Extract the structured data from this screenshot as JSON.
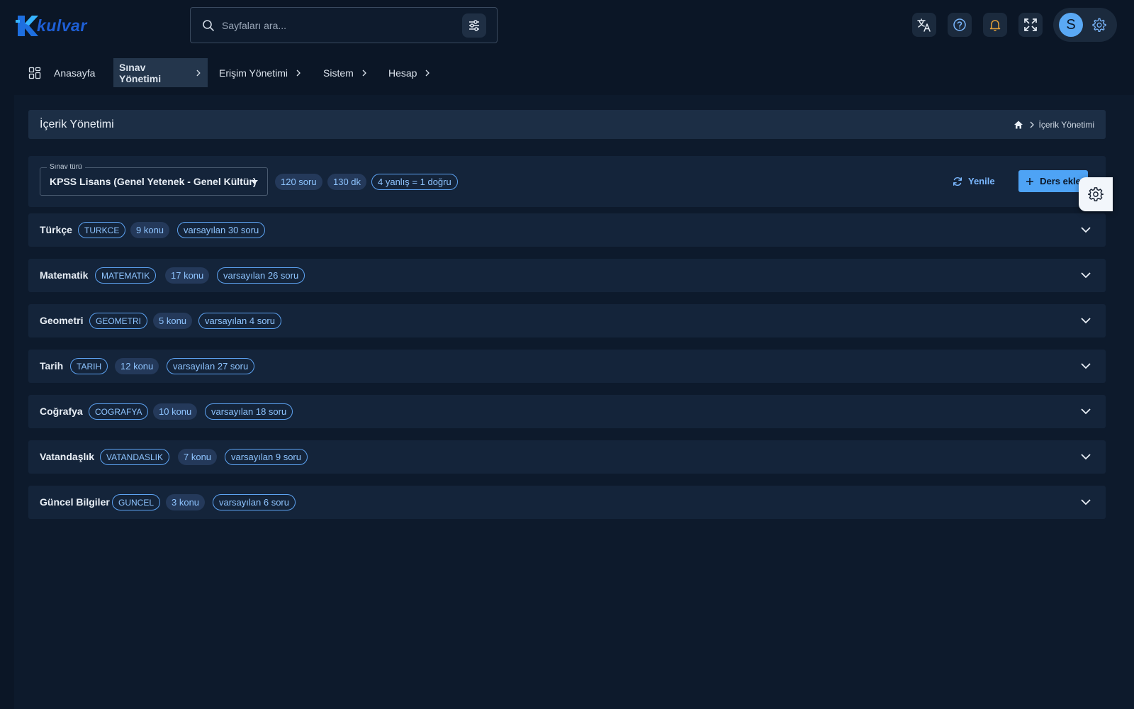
{
  "app": {
    "logo_text": "kulvar"
  },
  "search": {
    "placeholder": "Sayfaları ara..."
  },
  "header": {
    "avatar_letter": "S"
  },
  "nav": {
    "items": [
      {
        "label": "Anasayfa"
      },
      {
        "label": "Sınav Yönetimi"
      },
      {
        "label": "Erişim Yönetimi"
      },
      {
        "label": "Sistem"
      },
      {
        "label": "Hesap"
      }
    ]
  },
  "page": {
    "title": "İçerik Yönetimi",
    "breadcrumb": "İçerik Yönetimi"
  },
  "toolbar": {
    "select_legend": "Sınav türü",
    "select_value": "KPSS Lisans (Genel Yetenek - Genel Kültür)",
    "question_count": "120 soru",
    "duration": "130 dk",
    "rule": "4 yanlış = 1 doğru",
    "refresh_label": "Yenile",
    "add_label": "Ders ekle"
  },
  "subjects": [
    {
      "name": "Türkçe",
      "code": "TURKCE",
      "topics": "9 konu",
      "default": "varsayılan 30 soru"
    },
    {
      "name": "Matematik",
      "code": "MATEMATIK",
      "topics": "17 konu",
      "default": "varsayılan 26 soru"
    },
    {
      "name": "Geometri",
      "code": "GEOMETRI",
      "topics": "5 konu",
      "default": "varsayılan 4 soru"
    },
    {
      "name": "Tarih",
      "code": "TARIH",
      "topics": "12 konu",
      "default": "varsayılan 27 soru"
    },
    {
      "name": "Coğrafya",
      "code": "COGRAFYA",
      "topics": "10 konu",
      "default": "varsayılan 18 soru"
    },
    {
      "name": "Vatandaşlık",
      "code": "VATANDASLIK",
      "topics": "7 konu",
      "default": "varsayılan 9 soru"
    },
    {
      "name": "Güncel Bilgiler",
      "code": "GUNCEL",
      "topics": "3 konu",
      "default": "varsayılan 6 soru"
    }
  ],
  "colors": {
    "background": "#0b1626",
    "panel": "#14243a",
    "accent": "#4ea3f5",
    "chip_text": "#8ec4ff"
  }
}
